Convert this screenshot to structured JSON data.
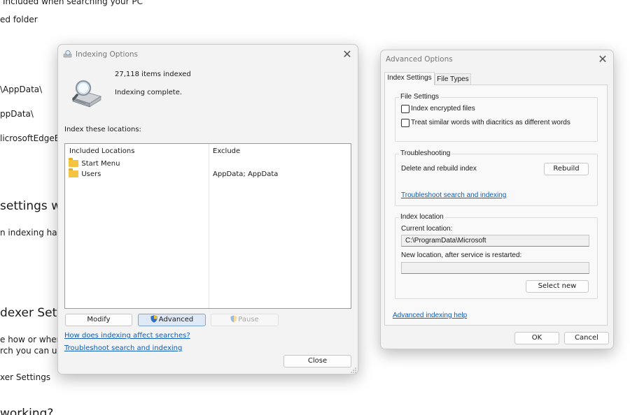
{
  "background": {
    "line1": "Included when searching your PC",
    "line2": "ed folder",
    "line3": "\\AppData\\",
    "line4": "ppData\\",
    "line5": "licrosoftEdgeBa",
    "line6": "settings wh",
    "line7": "n indexing happ",
    "line8": "dexer Settin",
    "line9": "e how or where",
    "line10": "rch you can us",
    "line11": "xer Settings",
    "line12": "working?"
  },
  "indexing_options": {
    "title": "Indexing Options",
    "items_indexed": "27,118 items indexed",
    "status": "Indexing complete.",
    "index_locations_label": "Index these locations:",
    "columns": {
      "included": "Included Locations",
      "exclude": "Exclude"
    },
    "rows": [
      {
        "location": "Start Menu",
        "exclude": ""
      },
      {
        "location": "Users",
        "exclude": "AppData; AppData"
      }
    ],
    "buttons": {
      "modify": "Modify",
      "advanced": "Advanced",
      "pause": "Pause",
      "close": "Close"
    },
    "links": {
      "how_affects": "How does indexing affect searches?",
      "troubleshoot": "Troubleshoot search and indexing"
    }
  },
  "advanced_options": {
    "title": "Advanced Options",
    "tabs": {
      "index_settings": "Index Settings",
      "file_types": "File Types"
    },
    "file_settings": {
      "title": "File Settings",
      "encrypted": "Index encrypted files",
      "diacritics": "Treat similar words with diacritics as different words"
    },
    "troubleshooting": {
      "title": "Troubleshooting",
      "delete_rebuild": "Delete and rebuild index",
      "rebuild_button": "Rebuild",
      "troubleshoot_link": "Troubleshoot search and indexing"
    },
    "index_location": {
      "title": "Index location",
      "current_label": "Current location:",
      "current_value": "C:\\ProgramData\\Microsoft",
      "new_label": "New location, after service is restarted:",
      "new_value": "",
      "select_new_button": "Select new"
    },
    "help_link": "Advanced indexing help",
    "ok_button": "OK",
    "cancel_button": "Cancel"
  },
  "colors": {
    "link": "#0f5db5",
    "folder": "#f3c341",
    "accent_focus": "#7aa6d6"
  }
}
